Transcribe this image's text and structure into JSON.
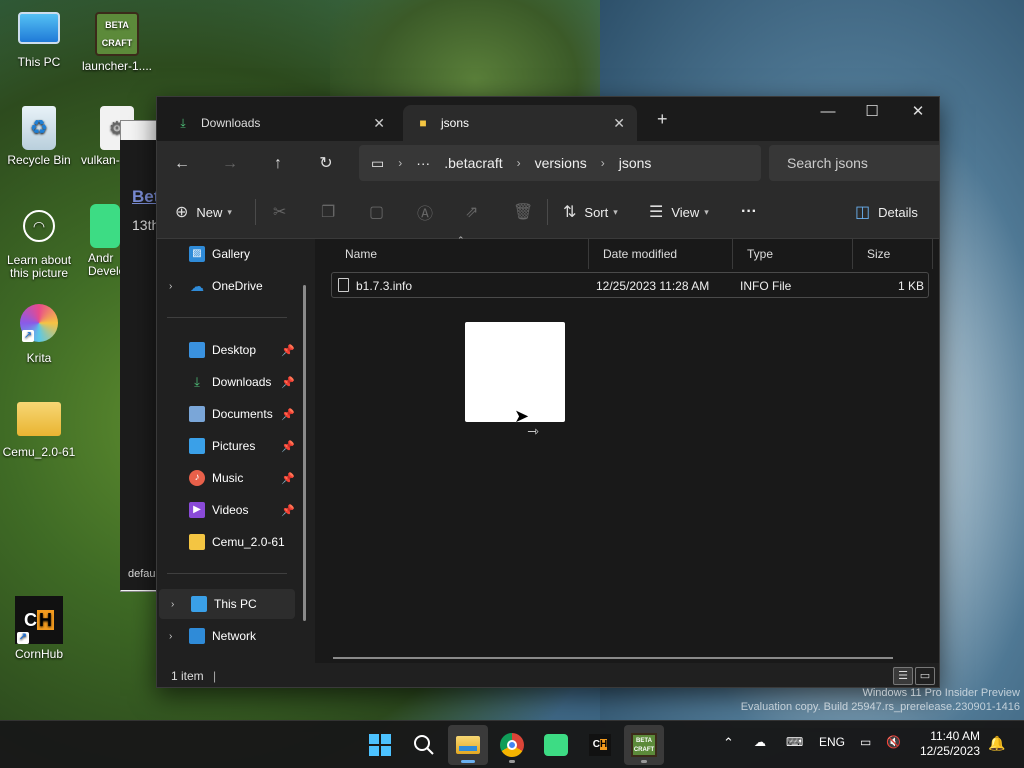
{
  "desktop": {
    "icons": [
      {
        "label": "This PC"
      },
      {
        "label": "launcher-1...."
      },
      {
        "label": "Recycle Bin"
      },
      {
        "label": "vulkan-"
      },
      {
        "label": "Learn about this picture"
      },
      {
        "label": "Andr Develo"
      },
      {
        "label": "Krita"
      },
      {
        "label": "Cemu_2.0-61"
      },
      {
        "label": "CornHub"
      }
    ]
  },
  "background_window": {
    "link_text": "Bet",
    "sub_text": "13th",
    "footer_text": "defau"
  },
  "explorer": {
    "tabs": [
      {
        "label": "Downloads",
        "icon": "download-icon"
      },
      {
        "label": "jsons",
        "icon": "folder-icon"
      }
    ],
    "new_tab_glyph": "+",
    "address": {
      "more": "···",
      "segments": [
        ".betacraft",
        "versions",
        "jsons"
      ]
    },
    "search_placeholder": "Search jsons",
    "commands": {
      "new_label": "New",
      "sort_label": "Sort",
      "view_label": "View",
      "more": "···",
      "details_label": "Details"
    },
    "nav": {
      "gallery": "Gallery",
      "onedrive": "OneDrive",
      "quick": [
        "Desktop",
        "Downloads",
        "Documents",
        "Pictures",
        "Music",
        "Videos",
        "Cemu_2.0-61"
      ],
      "thispc": "This PC",
      "network": "Network"
    },
    "columns": [
      "Name",
      "Date modified",
      "Type",
      "Size"
    ],
    "files": [
      {
        "name": "b1.7.3.info",
        "date": "12/25/2023 11:28 AM",
        "type": "INFO File",
        "size": "1 KB"
      }
    ],
    "status_text": "1 item"
  },
  "watermark": {
    "line1": "Windows 11 Pro Insider Preview",
    "line2": "Evaluation copy. Build 25947.rs_prerelease.230901-1416"
  },
  "taskbar": {
    "lang": "ENG",
    "time": "11:40 AM",
    "date": "12/25/2023"
  },
  "colors": {
    "accent": "#0078d4",
    "folder": "#f4c542",
    "window_bg": "#202020"
  }
}
